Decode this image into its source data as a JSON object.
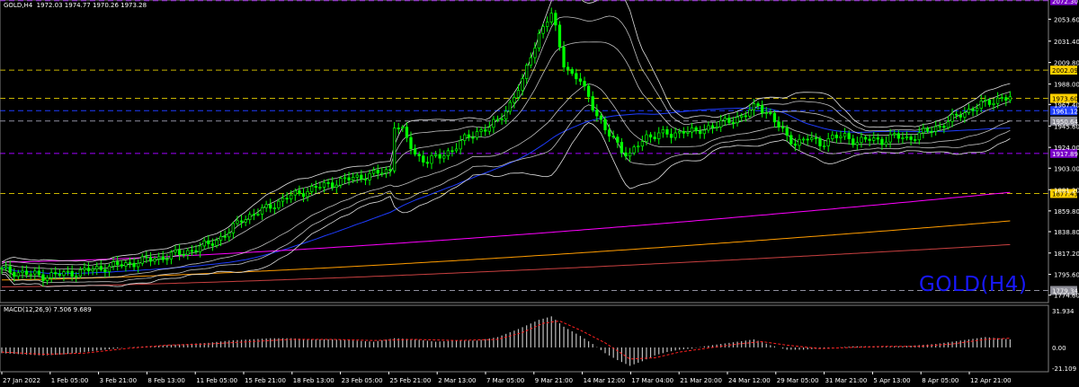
{
  "header": {
    "symbol": "GOLD,H4",
    "ohlc": "1972.03 1974.77 1970.26 1973.28"
  },
  "watermark": "GOLD(H4)",
  "macd_label": "MACD(12,26,9) 7.506 9.689",
  "colors": {
    "background": "#000000",
    "candle": "#00ff00",
    "bands": "#e0e0e0",
    "ma_blue": "#1e3cff",
    "ma_magenta": "#ff00ff",
    "ma_orange": "#ff9c00",
    "ma_red": "#c84040",
    "level_yellow": "#c8b400",
    "level_blue": "#1e3cff",
    "level_purple": "#a000ff",
    "level_gray": "#9090a0"
  },
  "chart_data": {
    "type": "line",
    "price_axis": {
      "ticks": [
        "2053.60",
        "2031.40",
        "2009.80",
        "1988.00",
        "1967.40",
        "1945.60",
        "1924.00",
        "1903.00",
        "1881.20",
        "1859.80",
        "1838.80",
        "1817.20",
        "1795.60",
        "1774.60"
      ],
      "range": [
        1768,
        2073
      ]
    },
    "time_axis": [
      "27 Jan 2022",
      "1 Feb 05:00",
      "3 Feb 21:00",
      "8 Feb 13:00",
      "11 Feb 05:00",
      "15 Feb 21:00",
      "18 Feb 13:00",
      "23 Feb 05:00",
      "25 Feb 21:00",
      "2 Mar 13:00",
      "7 Mar 05:00",
      "9 Mar 21:00",
      "14 Mar 12:00",
      "17 Mar 04:00",
      "21 Mar 20:00",
      "24 Mar 12:00",
      "29 Mar 05:00",
      "31 Mar 21:00",
      "5 Apr 13:00",
      "8 Apr 05:00",
      "12 Apr 21:00"
    ],
    "price_levels": [
      {
        "label": "2072.30",
        "type": "purple"
      },
      {
        "label": "2002.09",
        "type": "yellow"
      },
      {
        "label": "1973.60",
        "type": "yellow"
      },
      {
        "label": "1961.12",
        "type": "blue"
      },
      {
        "label": "1950.64",
        "type": "gray"
      },
      {
        "label": "1917.89",
        "type": "purple"
      },
      {
        "label": "1877.43",
        "type": "yellow"
      },
      {
        "label": "1779.34",
        "type": "gray"
      }
    ],
    "close_series": {
      "name": "",
      "points": [
        [
          0,
          1800
        ],
        [
          5,
          1797
        ],
        [
          10,
          1794
        ],
        [
          15,
          1796
        ],
        [
          20,
          1799
        ],
        [
          25,
          1803
        ],
        [
          30,
          1806
        ],
        [
          35,
          1810
        ],
        [
          40,
          1814
        ],
        [
          45,
          1819
        ],
        [
          50,
          1826
        ],
        [
          55,
          1838
        ],
        [
          58,
          1852
        ],
        [
          62,
          1858
        ],
        [
          66,
          1867
        ],
        [
          70,
          1875
        ],
        [
          75,
          1882
        ],
        [
          80,
          1888
        ],
        [
          85,
          1893
        ],
        [
          90,
          1897
        ],
        [
          94,
          1901
        ],
        [
          95,
          1948
        ],
        [
          97,
          1940
        ],
        [
          100,
          1917
        ],
        [
          103,
          1910
        ],
        [
          106,
          1915
        ],
        [
          109,
          1922
        ],
        [
          112,
          1932
        ],
        [
          115,
          1940
        ],
        [
          118,
          1944
        ],
        [
          120,
          1951
        ],
        [
          123,
          1968
        ],
        [
          126,
          1990
        ],
        [
          128,
          2018
        ],
        [
          130,
          2038
        ],
        [
          132,
          2052
        ],
        [
          133,
          2058
        ],
        [
          134,
          2044
        ],
        [
          136,
          2010
        ],
        [
          138,
          1996
        ],
        [
          140,
          1991
        ],
        [
          142,
          1975
        ],
        [
          144,
          1958
        ],
        [
          146,
          1940
        ],
        [
          148,
          1933
        ],
        [
          150,
          1922
        ],
        [
          152,
          1916
        ],
        [
          154,
          1926
        ],
        [
          156,
          1935
        ],
        [
          159,
          1938
        ],
        [
          162,
          1936
        ],
        [
          165,
          1942
        ],
        [
          168,
          1938
        ],
        [
          171,
          1945
        ],
        [
          174,
          1948
        ],
        [
          177,
          1952
        ],
        [
          180,
          1958
        ],
        [
          183,
          1966
        ],
        [
          186,
          1957
        ],
        [
          188,
          1945
        ],
        [
          190,
          1934
        ],
        [
          192,
          1929
        ],
        [
          195,
          1933
        ],
        [
          198,
          1928
        ],
        [
          201,
          1934
        ],
        [
          204,
          1935
        ],
        [
          207,
          1930
        ],
        [
          210,
          1932
        ],
        [
          213,
          1931
        ],
        [
          216,
          1935
        ],
        [
          219,
          1933
        ],
        [
          222,
          1937
        ],
        [
          225,
          1942
        ],
        [
          228,
          1948
        ],
        [
          231,
          1955
        ],
        [
          234,
          1962
        ],
        [
          237,
          1967
        ],
        [
          240,
          1971
        ],
        [
          242,
          1975
        ],
        [
          244,
          1973
        ]
      ]
    },
    "macd": {
      "axis_ticks": [
        "31.934",
        "0.00",
        "-21.109"
      ],
      "range": [
        -21.109,
        31.934
      ],
      "histogram": [
        [
          0,
          -5
        ],
        [
          5,
          -6
        ],
        [
          10,
          -7
        ],
        [
          15,
          -6
        ],
        [
          20,
          -4
        ],
        [
          25,
          -2
        ],
        [
          30,
          0
        ],
        [
          35,
          1
        ],
        [
          40,
          2
        ],
        [
          45,
          3
        ],
        [
          50,
          4
        ],
        [
          55,
          6
        ],
        [
          60,
          7
        ],
        [
          65,
          8
        ],
        [
          70,
          8
        ],
        [
          75,
          7
        ],
        [
          80,
          7
        ],
        [
          85,
          6
        ],
        [
          90,
          5
        ],
        [
          95,
          8
        ],
        [
          100,
          7
        ],
        [
          105,
          5
        ],
        [
          110,
          6
        ],
        [
          115,
          6
        ],
        [
          120,
          9
        ],
        [
          125,
          16
        ],
        [
          130,
          24
        ],
        [
          133,
          27
        ],
        [
          136,
          18
        ],
        [
          140,
          10
        ],
        [
          143,
          3
        ],
        [
          146,
          -5
        ],
        [
          149,
          -11
        ],
        [
          152,
          -16
        ],
        [
          155,
          -12
        ],
        [
          158,
          -7
        ],
        [
          161,
          -4
        ],
        [
          164,
          -2
        ],
        [
          167,
          -1
        ],
        [
          170,
          1
        ],
        [
          174,
          3
        ],
        [
          178,
          5
        ],
        [
          182,
          7
        ],
        [
          186,
          2
        ],
        [
          190,
          -2
        ],
        [
          194,
          -2
        ],
        [
          198,
          -1
        ],
        [
          202,
          0
        ],
        [
          206,
          1
        ],
        [
          210,
          1
        ],
        [
          214,
          1
        ],
        [
          218,
          1
        ],
        [
          222,
          2
        ],
        [
          226,
          3
        ],
        [
          230,
          5
        ],
        [
          234,
          7
        ],
        [
          238,
          9
        ],
        [
          241,
          8
        ],
        [
          244,
          7
        ]
      ],
      "signal": [
        [
          0,
          -4
        ],
        [
          10,
          -6
        ],
        [
          20,
          -5
        ],
        [
          30,
          -1
        ],
        [
          40,
          2
        ],
        [
          50,
          3
        ],
        [
          60,
          5
        ],
        [
          70,
          7
        ],
        [
          80,
          7
        ],
        [
          90,
          6
        ],
        [
          100,
          7
        ],
        [
          110,
          6
        ],
        [
          120,
          7
        ],
        [
          126,
          13
        ],
        [
          131,
          21
        ],
        [
          135,
          23
        ],
        [
          140,
          15
        ],
        [
          146,
          4
        ],
        [
          152,
          -10
        ],
        [
          158,
          -9
        ],
        [
          164,
          -4
        ],
        [
          170,
          -1
        ],
        [
          178,
          3
        ],
        [
          184,
          5
        ],
        [
          190,
          2
        ],
        [
          198,
          -1
        ],
        [
          206,
          0
        ],
        [
          214,
          1
        ],
        [
          222,
          1
        ],
        [
          230,
          3
        ],
        [
          238,
          7
        ],
        [
          244,
          8
        ]
      ]
    },
    "legend": "none",
    "grid": false
  }
}
